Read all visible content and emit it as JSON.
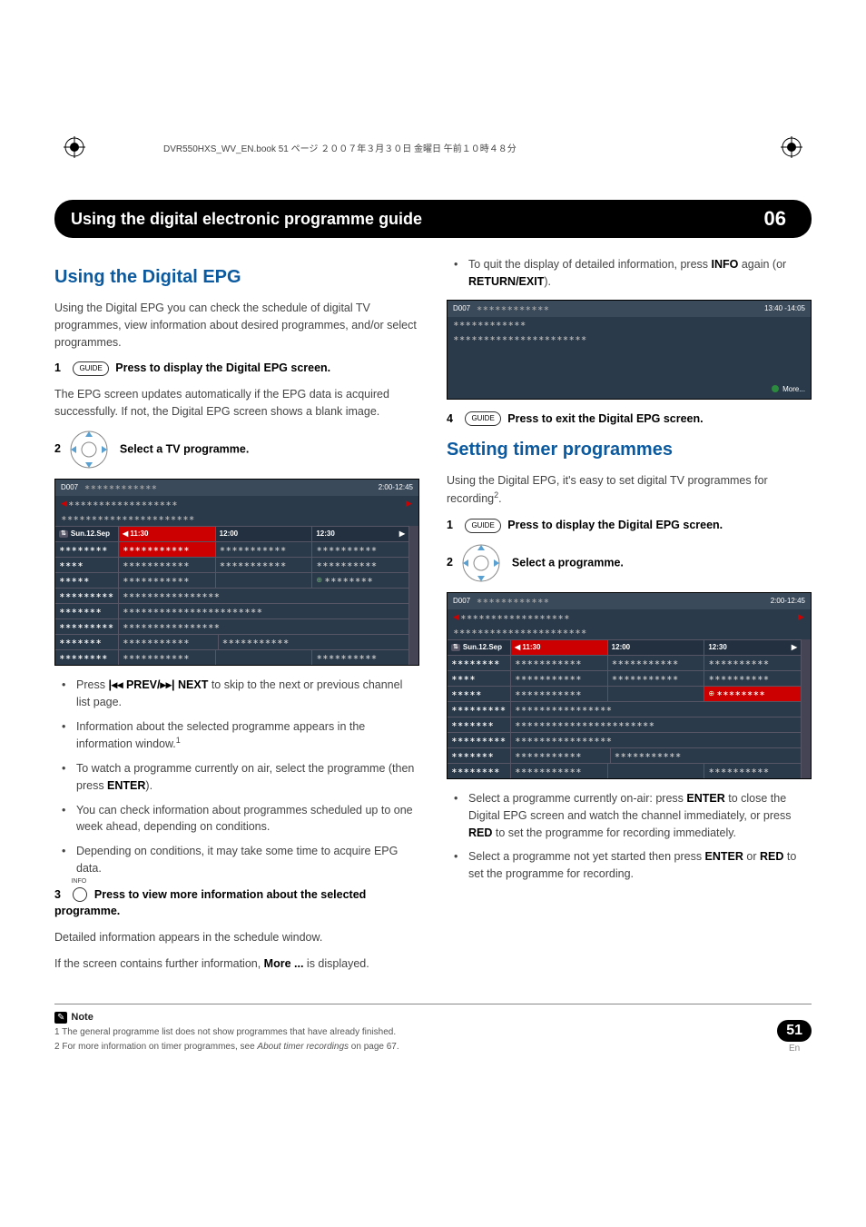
{
  "book_header": "DVR550HXS_WV_EN.book 51 ページ ２００７年３月３０日 金曜日 午前１０時４８分",
  "chapter": {
    "title": "Using the digital electronic programme guide",
    "number": "06"
  },
  "left": {
    "h2": "Using the Digital EPG",
    "intro": "Using the Digital EPG you can check the schedule of digital TV programmes, view information about desired programmes, and/or select programmes.",
    "step1_num": "1",
    "step1_btn": "GUIDE",
    "step1_text": "Press to display the Digital EPG screen.",
    "step1_body": "The EPG screen updates automatically if the EPG data is acquired successfully. If not, the Digital EPG screen shows a blank image.",
    "step2_num": "2",
    "step2_text": "Select a TV programme.",
    "epg": {
      "channel_code": "D007",
      "time_range": "2:00-12:45",
      "date": "Sun.12.Sep",
      "t1": "11:30",
      "t2": "12:00",
      "t3": "12:30"
    },
    "bl1_pre": "Press ",
    "bl1_mid": " PREV/",
    "bl1_mid2": " NEXT",
    "bl1_post": " to skip to the next or previous channel list page.",
    "bl2": "Information about the selected programme appears in the information window.",
    "bl3_a": "To watch a programme currently on air, select the programme (then press ",
    "bl3_b": "ENTER",
    "bl3_c": ").",
    "bl4": "You can check information about programmes scheduled up to one week ahead, depending on conditions.",
    "bl5": "Depending on conditions, it may take some time to acquire EPG data.",
    "step3_num": "3",
    "step3_sup": "INFO",
    "step3_text": "Press to view more information about the selected programme.",
    "step3_body": "Detailed information appears in the schedule window.",
    "step3_body2a": "If the screen contains further information, ",
    "step3_body2b": "More ...",
    "step3_body2c": " is displayed."
  },
  "right": {
    "top_bullet_a": "To quit the display of detailed information, press ",
    "top_bullet_b": "INFO",
    "top_bullet_c": " again (or ",
    "top_bullet_d": "RETURN/EXIT",
    "top_bullet_e": ").",
    "info": {
      "channel_code": "D007",
      "time": "13:40 -14:05",
      "more": "More..."
    },
    "step4_num": "4",
    "step4_btn": "GUIDE",
    "step4_text": "Press to exit the Digital EPG screen.",
    "h2": "Setting timer programmes",
    "intro_a": "Using the Digital EPG, it's easy to set digital TV programmes for recording",
    "intro_b": ".",
    "step1_num": "1",
    "step1_btn": "GUIDE",
    "step1_text": "Press to display the Digital EPG screen.",
    "step2_num": "2",
    "step2_text": "Select a programme.",
    "epg": {
      "channel_code": "D007",
      "time_range": "2:00-12:45",
      "date": "Sun.12.Sep",
      "t1": "11:30",
      "t2": "12:00",
      "t3": "12:30"
    },
    "bl1_a": "Select a programme currently on-air: press ",
    "bl1_b": "ENTER",
    "bl1_c": " to close the Digital EPG screen and watch the channel immediately, or press ",
    "bl1_d": "RED",
    "bl1_e": " to set the programme for recording immediately.",
    "bl2_a": "Select a programme not yet started then press ",
    "bl2_b": "ENTER",
    "bl2_c": " or ",
    "bl2_d": "RED",
    "bl2_e": " to set the programme for recording."
  },
  "notes": {
    "label": "Note",
    "n1": "1 The general programme list does not show programmes that have already finished.",
    "n2_a": "2 For more information on timer programmes, see ",
    "n2_b": "About timer recordings",
    "n2_c": " on page 67."
  },
  "page": {
    "num": "51",
    "lang": "En"
  },
  "glyph": {
    "prev": "◂◂",
    "next": "▸▸",
    "prev_bar": "|◂◂",
    "next_bar": "▸▸|",
    "left_arrow": "◀",
    "right_arrow": "▶",
    "updown": "⇅"
  }
}
